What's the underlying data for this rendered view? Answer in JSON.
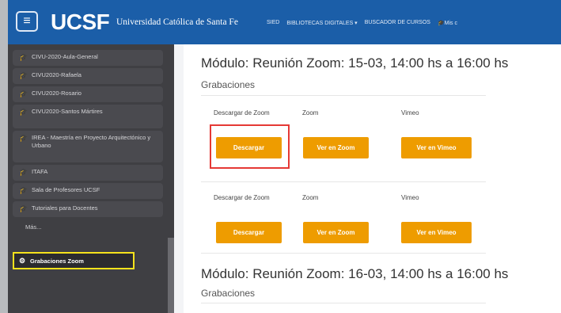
{
  "header": {
    "menu_icon": "hamburger-icon",
    "logo": "UCSF",
    "logo_subtitle": "Universidad Católica de Santa Fe",
    "nav": [
      "SIED",
      "BIBLIOTECAS DIGITALES ▾",
      "BUSCADOR DE CURSOS",
      "Mis c"
    ],
    "nav_icon": "graduation-cap-icon",
    "bar_color": "#1b5ea8"
  },
  "sidebar": {
    "items": [
      {
        "label": "CIVU-2020-Aula-General",
        "icon": "graduation-cap-icon"
      },
      {
        "label": "CIVU2020-Rafaela",
        "icon": "graduation-cap-icon"
      },
      {
        "label": "CIVU2020-Rosario",
        "icon": "graduation-cap-icon"
      },
      {
        "label": "CIVU2020-Santos Mártires",
        "icon": "graduation-cap-icon"
      },
      {
        "label": "IREA - Maestría en Proyecto Arquitectónico y Urbano",
        "icon": "graduation-cap-icon"
      },
      {
        "label": "ITAFA",
        "icon": "graduation-cap-icon"
      },
      {
        "label": "Sala de Profesores UCSF",
        "icon": "graduation-cap-icon"
      },
      {
        "label": "Tutoriales para Docentes",
        "icon": "graduation-cap-icon"
      }
    ],
    "more": "Más...",
    "active": {
      "label": "Grabaciones Zoom",
      "icon": "gear-icon"
    },
    "highlight_color": "#f5e21c"
  },
  "main": {
    "modules": [
      {
        "title": "Módulo: Reunión Zoom: 15-03, 14:00 hs a 16:00 hs",
        "subtitle": "Grabaciones",
        "rows": [
          {
            "cols": [
              "Descargar de Zoom",
              "Zoom",
              "Vimeo"
            ],
            "buttons": [
              "Descargar",
              "Ver en Zoom",
              "Ver en Vimeo"
            ]
          },
          {
            "cols": [
              "Descargar de Zoom",
              "Zoom",
              "Vimeo"
            ],
            "buttons": [
              "Descargar",
              "Ver en Zoom",
              "Ver en Vimeo"
            ]
          }
        ]
      },
      {
        "title": "Módulo: Reunión Zoom: 16-03, 14:00 hs a 16:00 hs",
        "subtitle": "Grabaciones"
      }
    ],
    "button_color": "#ee9c00",
    "highlight_color": "#e53935"
  }
}
